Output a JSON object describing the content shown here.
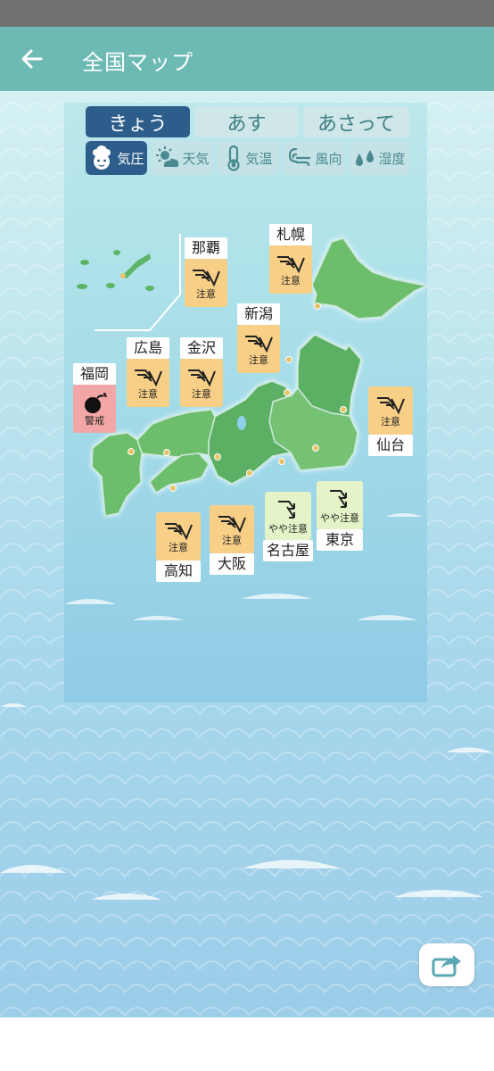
{
  "app_bar": {
    "title": "全国マップ",
    "back_icon": "arrow-left-icon"
  },
  "day_tabs": [
    {
      "label": "きょう",
      "selected": true
    },
    {
      "label": "あす",
      "selected": false
    },
    {
      "label": "あさって",
      "selected": false
    }
  ],
  "mode_tabs": [
    {
      "label": "気圧",
      "icon": "zutool-mascot-icon",
      "selected": true
    },
    {
      "label": "天気",
      "icon": "sun-cloud-icon",
      "selected": false
    },
    {
      "label": "気温",
      "icon": "thermometer-icon",
      "selected": false
    },
    {
      "label": "風向",
      "icon": "wind-icon",
      "selected": false
    },
    {
      "label": "湿度",
      "icon": "droplets-icon",
      "selected": false
    }
  ],
  "cities": {
    "naha": {
      "name": "那覇",
      "level": "注意"
    },
    "sapporo": {
      "name": "札幌",
      "level": "注意"
    },
    "niigata": {
      "name": "新潟",
      "level": "注意"
    },
    "hiroshima": {
      "name": "広島",
      "level": "注意"
    },
    "kanazawa": {
      "name": "金沢",
      "level": "注意"
    },
    "fukuoka": {
      "name": "福岡",
      "level": "警戒"
    },
    "sendai": {
      "name": "仙台",
      "level": "注意"
    },
    "kochi": {
      "name": "高知",
      "level": "注意"
    },
    "osaka": {
      "name": "大阪",
      "level": "注意"
    },
    "nagoya": {
      "name": "名古屋",
      "level": "やや注意"
    },
    "tokyo": {
      "name": "東京",
      "level": "やや注意"
    }
  },
  "level_colors": {
    "注意": "#f8cf87",
    "警戒": "#f2a6a6",
    "やや注意": "#e4f4c8"
  },
  "accent_colors": {
    "app_bar": "#6dbab4",
    "selected_tab": "#2d5d8a"
  },
  "share_button": {
    "icon": "share-icon"
  }
}
